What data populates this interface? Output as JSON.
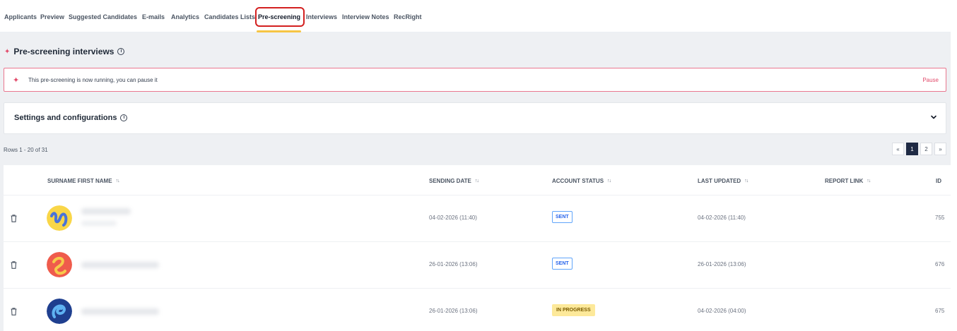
{
  "tabs": [
    {
      "label": "Applicants"
    },
    {
      "label": "Preview"
    },
    {
      "label": "Suggested Candidates"
    },
    {
      "label": "E-mails"
    },
    {
      "label": "Analytics"
    },
    {
      "label": "Candidates Lists"
    },
    {
      "label": "Pre-screening",
      "active": true
    },
    {
      "label": "Interviews"
    },
    {
      "label": "Interview Notes"
    },
    {
      "label": "RecRight"
    }
  ],
  "section": {
    "title": "Pre-screening interviews"
  },
  "banner": {
    "message": "This pre-screening is now running, you can pause it",
    "action_label": "Pause"
  },
  "settings": {
    "title": "Settings and configurations"
  },
  "table_info": {
    "rows_label": "Rows 1 - 20 of 31"
  },
  "pagination": {
    "prev": "«",
    "pages": [
      "1",
      "2"
    ],
    "current": "1",
    "next": "»"
  },
  "table": {
    "columns": [
      "SURNAME FIRST NAME",
      "SENDING DATE",
      "ACCOUNT STATUS",
      "LAST UPDATED",
      "REPORT LINK",
      "ID"
    ],
    "rows": [
      {
        "sending_date": "04-02-2026 (11:40)",
        "status": "SENT",
        "last_updated": "04-02-2026 (11:40)",
        "report_link": "",
        "id": "755",
        "avatar_color": "#f9d648"
      },
      {
        "sending_date": "26-01-2026 (13:06)",
        "status": "SENT",
        "last_updated": "26-01-2026 (13:06)",
        "report_link": "",
        "id": "676",
        "avatar_color": "#ef5b4c"
      },
      {
        "sending_date": "26-01-2026 (13:06)",
        "status": "IN PROGRESS",
        "last_updated": "04-02-2026 (04:00)",
        "report_link": "",
        "id": "675",
        "avatar_color": "#1f3f8f"
      }
    ]
  },
  "colors": {
    "accent": "#e24b6b",
    "tab_underline": "#f6c544",
    "highlight": "#d32020",
    "pagination_active": "#1f2a44"
  }
}
